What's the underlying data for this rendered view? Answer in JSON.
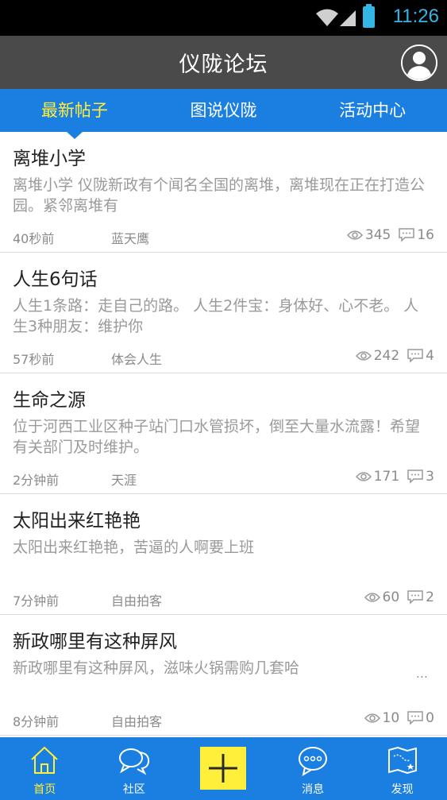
{
  "status_bar": {
    "time": "11:26",
    "accent_color": "#33b5e5"
  },
  "header": {
    "title": "仪陇论坛",
    "profile_icon": "user-avatar-icon"
  },
  "tabs": [
    {
      "label": "最新帖子",
      "active": true
    },
    {
      "label": "图说仪陇",
      "active": false
    },
    {
      "label": "活动中心",
      "active": false
    }
  ],
  "posts": [
    {
      "title": "离堆小学",
      "excerpt": "离堆小学      仪陇新政有个闻名全国的离堆，离堆现在正在打造公园。紧邻离堆有",
      "more": "",
      "time": "40秒前",
      "author": "蓝天鹰",
      "views": "345",
      "comments": "16"
    },
    {
      "title": "人生6句话",
      "excerpt": "人生1条路：走自己的路。 人生2件宝：身体好、心不老。 人生3种朋友：维护你",
      "more": "",
      "time": "57秒前",
      "author": "体会人生",
      "views": "242",
      "comments": "4"
    },
    {
      "title": "生命之源",
      "excerpt": "位于河西工业区种子站门口水管损坏，倒至大量水流露！希望有关部门及时维护。",
      "more": "",
      "time": "2分钟前",
      "author": "天涯",
      "views": "171",
      "comments": "3"
    },
    {
      "title": "太阳出来红艳艳",
      "excerpt": "太阳出来红艳艳，苦逼的人啊要上班",
      "more": "",
      "time": "7分钟前",
      "author": "自由拍客",
      "views": "60",
      "comments": "2"
    },
    {
      "title": "新政哪里有这种屏风",
      "excerpt": "新政哪里有这种屏风，滋味火锅需购几套哈",
      "more": "...",
      "time": "8分钟前",
      "author": "自由拍客",
      "views": "10",
      "comments": "0"
    }
  ],
  "bottom_nav": [
    {
      "label": "首页",
      "icon": "home-icon",
      "active": true
    },
    {
      "label": "社区",
      "icon": "chat-bubbles-icon",
      "active": false
    },
    {
      "label": "",
      "icon": "plus-icon",
      "active": false
    },
    {
      "label": "消息",
      "icon": "message-icon",
      "active": false
    },
    {
      "label": "发现",
      "icon": "map-icon",
      "active": false
    }
  ],
  "colors": {
    "primary": "#1a7fe0",
    "highlight": "#ffef3a",
    "header": "#4a4a4a"
  }
}
